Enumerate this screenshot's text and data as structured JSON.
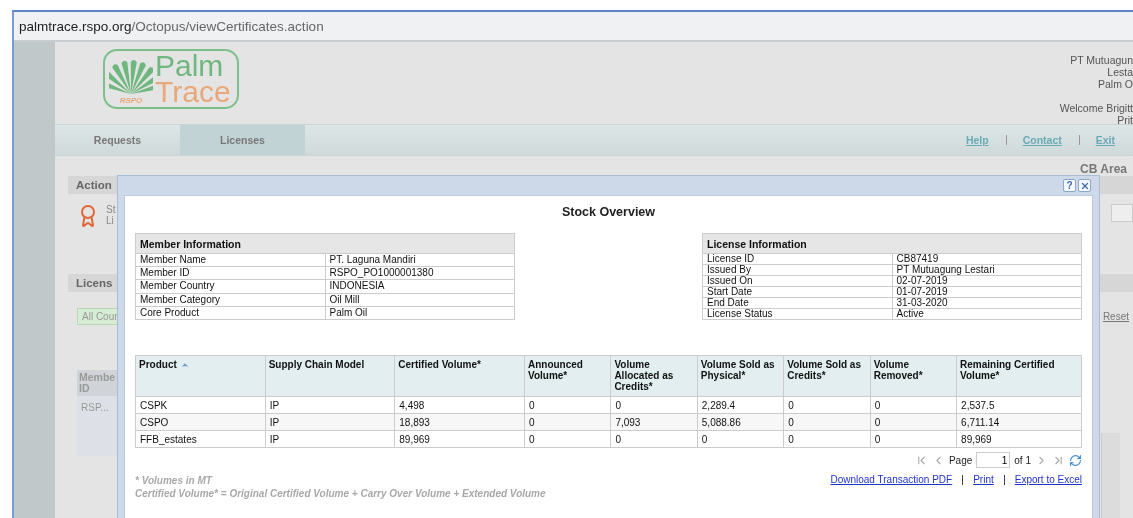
{
  "browser": {
    "url_host": "palmtrace.rspo.org",
    "url_path": "/Octopus/viewCertificates.action"
  },
  "header": {
    "logo": {
      "word1": "Palm",
      "word2": "Trace",
      "badge": "RSPO"
    },
    "user_lines": [
      "PT Mutuagun",
      "Lesta",
      "Palm O"
    ],
    "welcome_lines": [
      "Welcome Brigitt",
      "Prit"
    ]
  },
  "nav": {
    "tabs": [
      {
        "label": "Requests",
        "selected": false
      },
      {
        "label": "Licenses",
        "selected": true
      }
    ],
    "links": [
      "Help",
      "Contact",
      "Exit"
    ]
  },
  "area_title": "CB Area",
  "action_panel": {
    "title": "Action",
    "lines": [
      "St",
      "Li"
    ]
  },
  "license_panel": {
    "title": "Licens",
    "filter_button": "All Cour",
    "reset_link": "Reset",
    "table_header": "Membe ID",
    "cell": "RSP..."
  },
  "dialog": {
    "help_button": "?",
    "title": "Stock Overview",
    "member_info": {
      "title": "Member Information",
      "rows": [
        {
          "label": "Member Name",
          "value": "PT. Laguna Mandiri"
        },
        {
          "label": "Member ID",
          "value": "RSPO_PO1000001380"
        },
        {
          "label": "Member Country",
          "value": "INDONESIA"
        },
        {
          "label": "Member Category",
          "value": "Oil Mill"
        },
        {
          "label": "Core Product",
          "value": "Palm Oil"
        }
      ]
    },
    "license_info": {
      "title": "License Information",
      "rows": [
        {
          "label": "License ID",
          "value": "CB87419"
        },
        {
          "label": "Issued By",
          "value": "PT Mutuagung Lestari"
        },
        {
          "label": "Issued On",
          "value": "02-07-2019"
        },
        {
          "label": "Start Date",
          "value": "01-07-2019"
        },
        {
          "label": "End Date",
          "value": "31-03-2020"
        },
        {
          "label": "License Status",
          "value": "Active"
        }
      ]
    },
    "table": {
      "columns": [
        {
          "label": "Product",
          "sorted": true
        },
        {
          "label": "Supply Chain Model",
          "sorted": false
        },
        {
          "label": "Certified Volume*",
          "sorted": false
        },
        {
          "label": "Announced Volume*",
          "sorted": false
        },
        {
          "label": "Volume Allocated as Credits*",
          "sorted": false
        },
        {
          "label": "Volume Sold as Physical*",
          "sorted": false
        },
        {
          "label": "Volume Sold as Credits*",
          "sorted": false
        },
        {
          "label": "Volume Removed*",
          "sorted": false
        },
        {
          "label": "Remaining Certified Volume*",
          "sorted": false
        }
      ],
      "rows": [
        [
          "CSPK",
          "IP",
          "4,498",
          "0",
          "0",
          "2,289.4",
          "0",
          "0",
          "2,537.5"
        ],
        [
          "CSPO",
          "IP",
          "18,893",
          "0",
          "7,093",
          "5,088.86",
          "0",
          "0",
          "6,711.14"
        ],
        [
          "FFB_estates",
          "IP",
          "89,969",
          "0",
          "0",
          "0",
          "0",
          "0",
          "89,969"
        ]
      ]
    },
    "pager": {
      "label": "Page",
      "page": "1",
      "of": "of 1"
    },
    "links": [
      "Download Transaction PDF",
      "Print",
      "Export to Excel"
    ],
    "notes": [
      "* Volumes in MT",
      "Certified Volume* =  Original Certified Volume  +  Carry Over Volume + Extended Volume"
    ]
  }
}
